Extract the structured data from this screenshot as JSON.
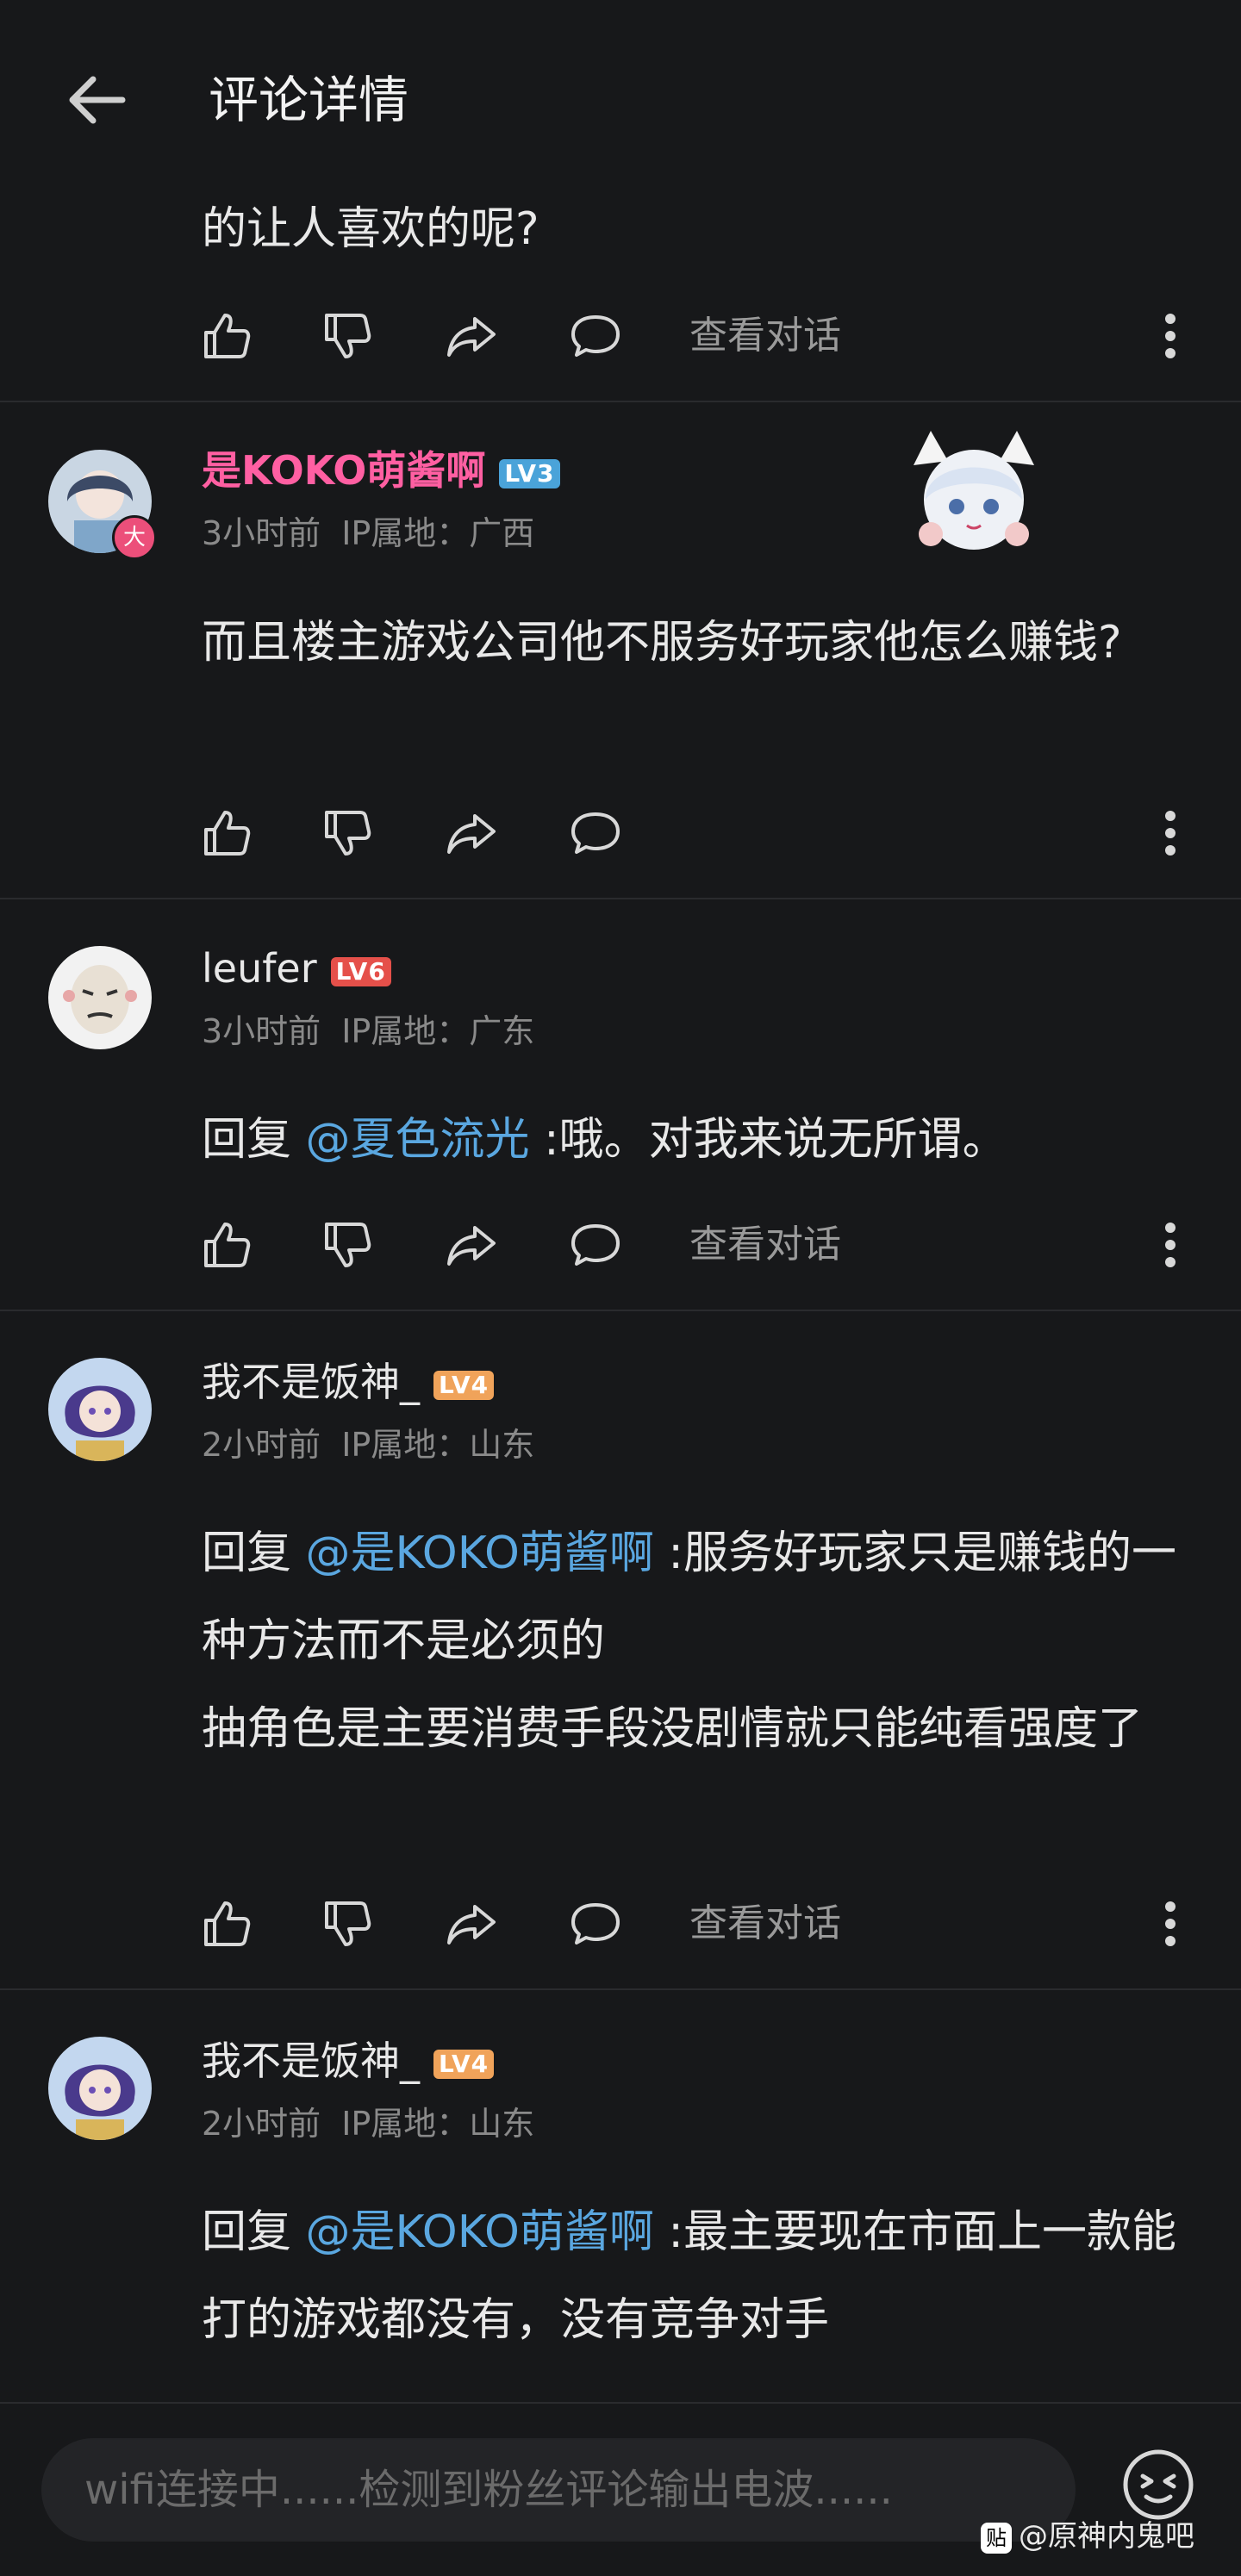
{
  "header": {
    "title": "评论详情"
  },
  "top_comment": {
    "text": "的让人喜欢的呢?"
  },
  "actions": {
    "view_conversation": "查看对话"
  },
  "comments": [
    {
      "user": "是KOKO萌酱啊",
      "level": "LV3",
      "time": "3小时前",
      "ip": "IP属地：广西",
      "badge": "大",
      "body": "而且楼主游戏公司他不服务好玩家他怎么赚钱?"
    },
    {
      "user": "leufer",
      "level": "LV6",
      "time": "3小时前",
      "ip": "IP属地：广东",
      "reply_prefix": "回复 ",
      "mention": "@夏色流光",
      "body": " :哦。对我来说无所谓。"
    },
    {
      "user": "我不是饭神_",
      "level": "LV4",
      "time": "2小时前",
      "ip": "IP属地：山东",
      "reply_prefix": "回复 ",
      "mention": "@是KOKO萌酱啊",
      "body": " :服务好玩家只是赚钱的一种方法而不是必须的",
      "body2": "抽角色是主要消费手段没剧情就只能纯看强度了"
    },
    {
      "user": "我不是饭神_",
      "level": "LV4",
      "time": "2小时前",
      "ip": "IP属地：山东",
      "reply_prefix": "回复 ",
      "mention": "@是KOKO萌酱啊",
      "body": " :最主要现在市面上一款能打的游戏都没有，没有竞争对手"
    }
  ],
  "input": {
    "placeholder": "wifi连接中......检测到粉丝评论输出电波......"
  },
  "watermark": {
    "logo": "贴",
    "text": "@原神内鬼吧"
  },
  "colors": {
    "background": "#17181a",
    "mention": "#5aa7e0",
    "vip_name": "#ff5fa2"
  }
}
